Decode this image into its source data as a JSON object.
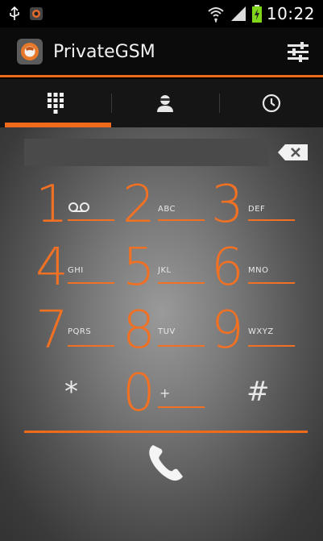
{
  "status_bar": {
    "time": "10:22"
  },
  "app": {
    "title": "PrivateGSM"
  },
  "tabs": [
    {
      "name": "dialpad"
    },
    {
      "name": "contacts"
    },
    {
      "name": "history"
    }
  ],
  "dialer": {
    "number": "",
    "keys": [
      {
        "digit": "1",
        "letters": "voicemail"
      },
      {
        "digit": "2",
        "letters": "ABC"
      },
      {
        "digit": "3",
        "letters": "DEF"
      },
      {
        "digit": "4",
        "letters": "GHI"
      },
      {
        "digit": "5",
        "letters": "JKL"
      },
      {
        "digit": "6",
        "letters": "MNO"
      },
      {
        "digit": "7",
        "letters": "PQRS"
      },
      {
        "digit": "8",
        "letters": "TUV"
      },
      {
        "digit": "9",
        "letters": "WXYZ"
      },
      {
        "digit": "*",
        "letters": ""
      },
      {
        "digit": "0",
        "letters": "+"
      },
      {
        "digit": "#",
        "letters": ""
      }
    ]
  },
  "colors": {
    "accent": "#ef6a1a",
    "digit": "#f07024"
  }
}
